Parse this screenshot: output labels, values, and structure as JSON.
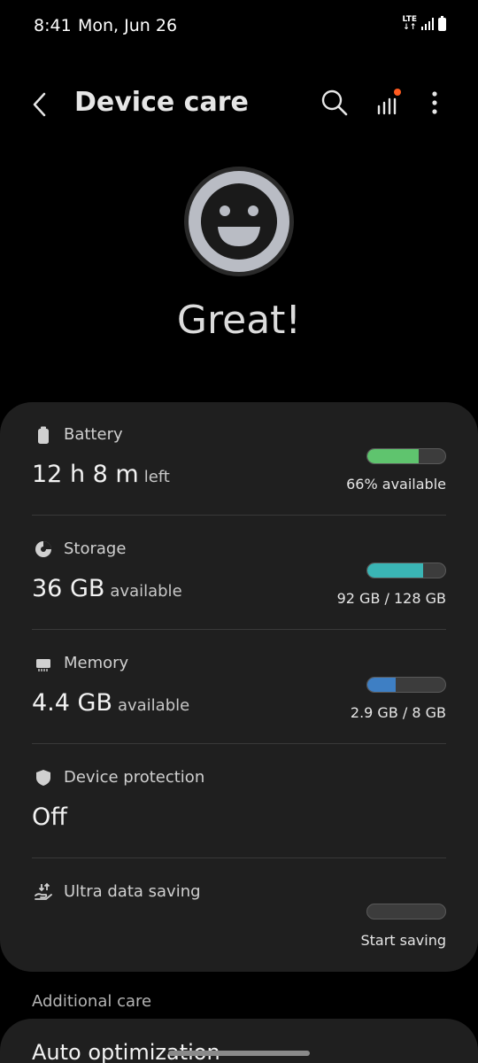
{
  "status_bar": {
    "time": "8:41",
    "date": "Mon, Jun 26",
    "network": "LTE"
  },
  "app_bar": {
    "title": "Device care"
  },
  "status": {
    "label": "Great!",
    "face_icon": "smile-face-icon"
  },
  "sections": {
    "battery": {
      "title": "Battery",
      "value": "12 h 8 m",
      "unit": "left",
      "detail": "66% available",
      "level": 0.66,
      "color": "#5fc46e"
    },
    "storage": {
      "title": "Storage",
      "value": "36 GB",
      "unit": "available",
      "detail": "92 GB / 128 GB",
      "level": 0.72,
      "color": "#3ab5b5"
    },
    "memory": {
      "title": "Memory",
      "value": "4.4 GB",
      "unit": "available",
      "detail": "2.9 GB / 8 GB",
      "level": 0.36,
      "color": "#3e7fc4"
    },
    "protection": {
      "title": "Device protection",
      "value": "Off"
    },
    "data_saving": {
      "title": "Ultra data saving",
      "detail": "Start saving",
      "level": 0
    }
  },
  "additional": {
    "label": "Additional care",
    "auto_optimization": "Auto optimization"
  },
  "colors": {
    "background": "#000000",
    "card": "#1f1f1f",
    "accent_dot": "#ff5a1f"
  }
}
